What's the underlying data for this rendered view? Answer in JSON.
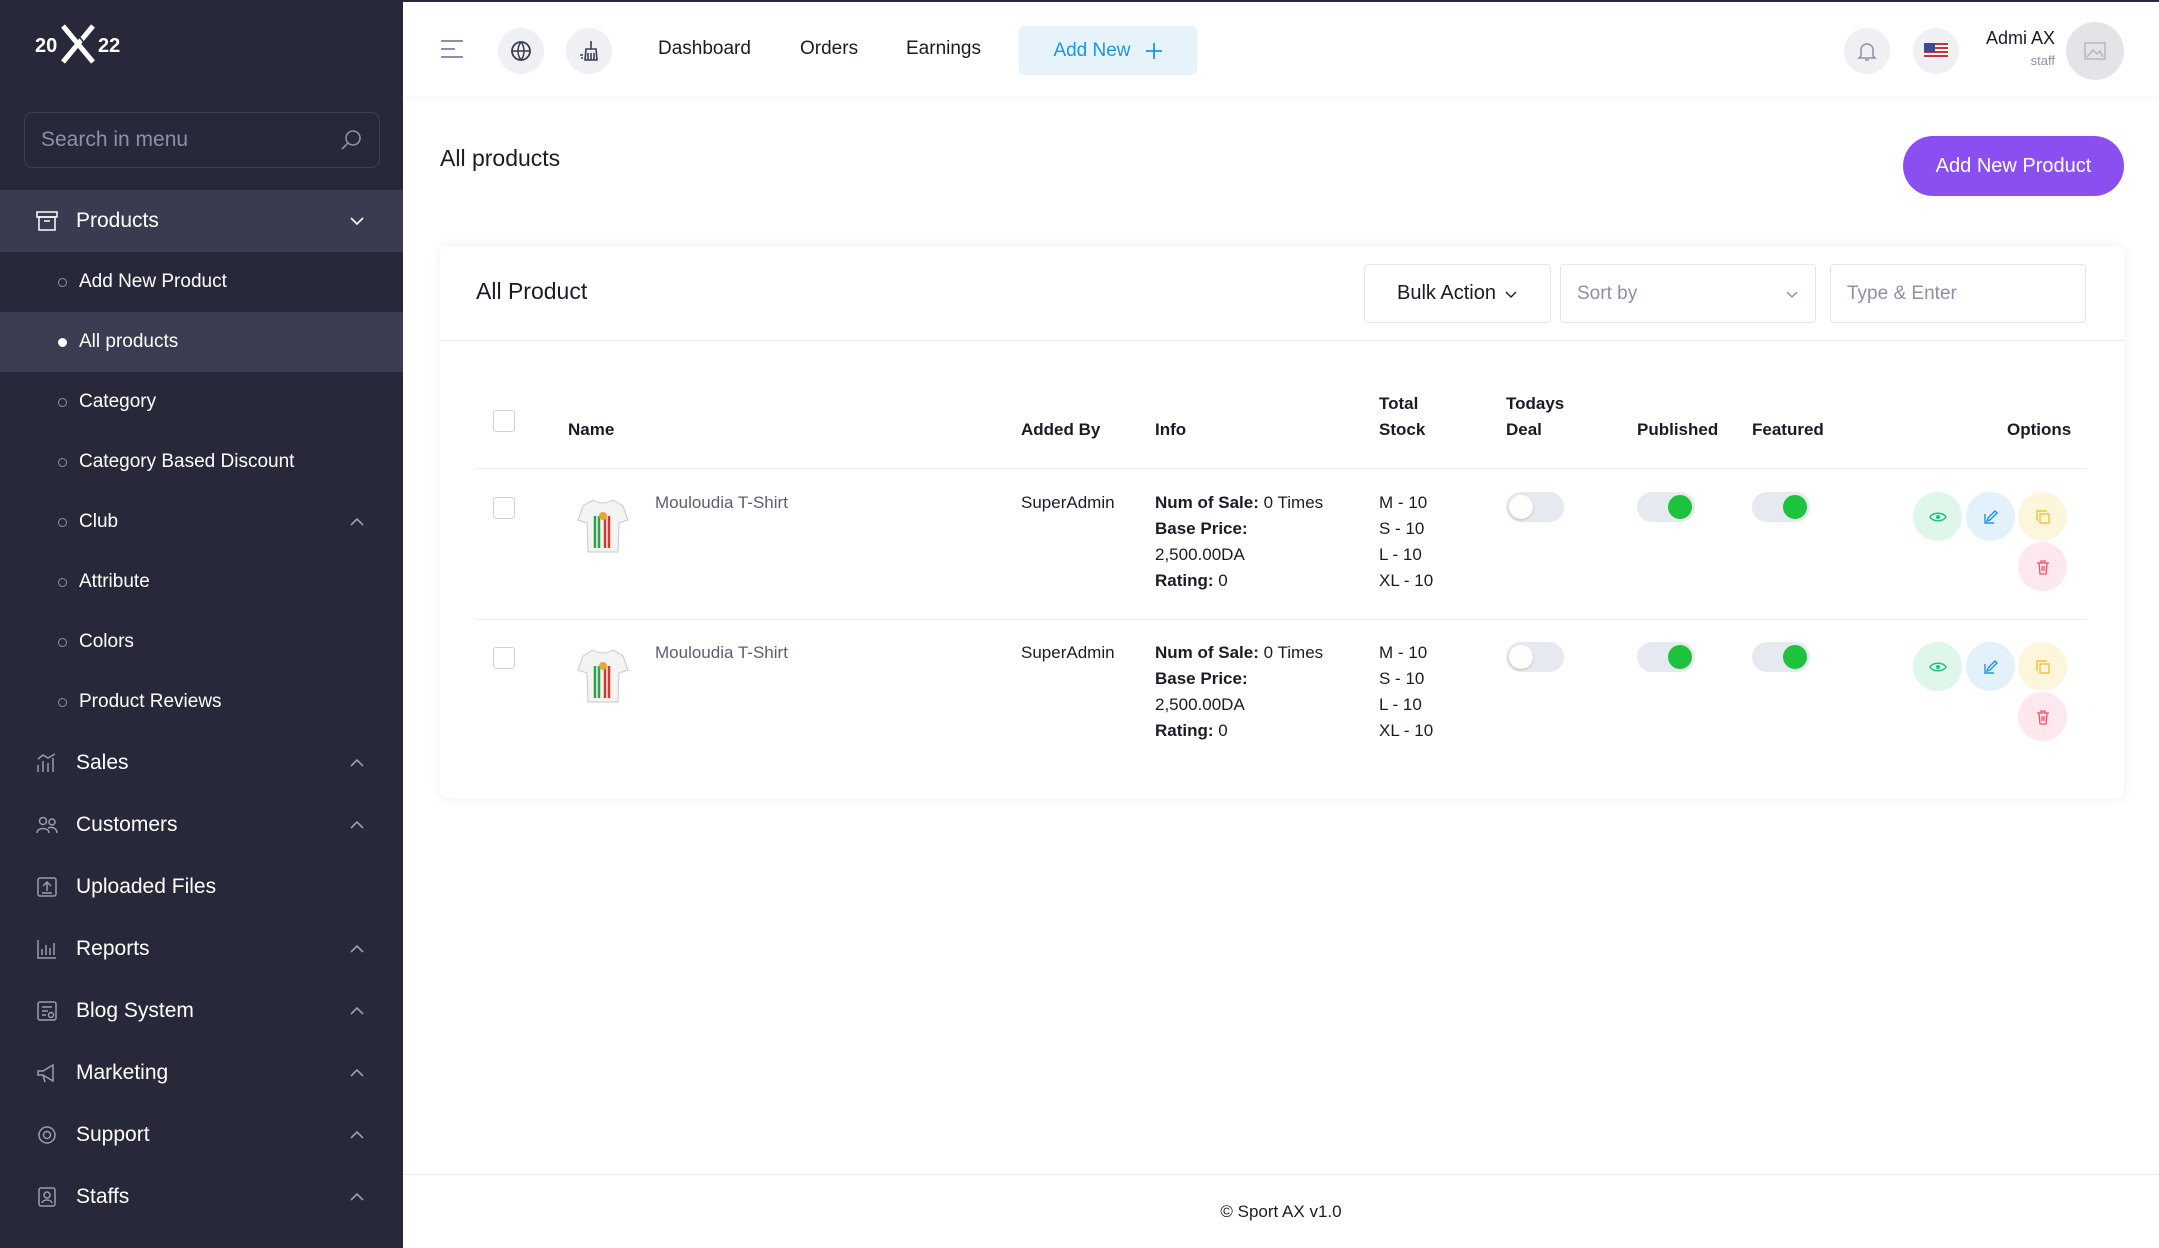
{
  "brand": {
    "logo_text": "20X22"
  },
  "sidebar": {
    "search_placeholder": "Search in menu",
    "products": {
      "label": "Products",
      "sub_items": [
        {
          "label": "Add New Product"
        },
        {
          "label": "All products"
        },
        {
          "label": "Category"
        },
        {
          "label": "Category Based Discount"
        },
        {
          "label": "Club"
        },
        {
          "label": "Attribute"
        },
        {
          "label": "Colors"
        },
        {
          "label": "Product Reviews"
        }
      ]
    },
    "items": [
      {
        "label": "Sales",
        "icon": "sales-icon"
      },
      {
        "label": "Customers",
        "icon": "customers-icon"
      },
      {
        "label": "Uploaded Files",
        "icon": "upload-icon"
      },
      {
        "label": "Reports",
        "icon": "reports-icon"
      },
      {
        "label": "Blog System",
        "icon": "blog-icon"
      },
      {
        "label": "Marketing",
        "icon": "megaphone-icon"
      },
      {
        "label": "Support",
        "icon": "support-icon"
      },
      {
        "label": "Staffs",
        "icon": "staff-icon"
      }
    ]
  },
  "topbar": {
    "links": [
      "Dashboard",
      "Orders",
      "Earnings"
    ],
    "add_new": "Add New",
    "user": {
      "name": "Admi AX",
      "role": "staff"
    }
  },
  "page": {
    "title": "All products",
    "add_button": "Add New Product"
  },
  "card": {
    "title": "All Product",
    "bulk_action": "Bulk Action",
    "sort_placeholder": "Sort by",
    "search_placeholder": "Type & Enter"
  },
  "table": {
    "headers": {
      "name": "Name",
      "added_by": "Added By",
      "info": "Info",
      "total_stock_1": "Total",
      "total_stock_2": "Stock",
      "todays_deal_1": "Todays",
      "todays_deal_2": "Deal",
      "published": "Published",
      "featured": "Featured",
      "options": "Options"
    },
    "rows": [
      {
        "name": "Mouloudia T-Shirt",
        "added_by": "SuperAdmin",
        "num_of_sale_label": "Num of Sale:",
        "num_of_sale_value": "0 Times",
        "base_price_label": "Base Price:",
        "base_price_value": "2,500.00DA",
        "rating_label": "Rating:",
        "rating_value": "0",
        "stock": [
          "M - 10",
          "S - 10",
          "L - 10",
          "XL - 10"
        ],
        "todays_deal": false,
        "published": true,
        "featured": true
      },
      {
        "name": "Mouloudia T-Shirt",
        "added_by": "SuperAdmin",
        "num_of_sale_label": "Num of Sale:",
        "num_of_sale_value": "0 Times",
        "base_price_label": "Base Price:",
        "base_price_value": "2,500.00DA",
        "rating_label": "Rating:",
        "rating_value": "0",
        "stock": [
          "M - 10",
          "S - 10",
          "L - 10",
          "XL - 10"
        ],
        "todays_deal": false,
        "published": true,
        "featured": true
      }
    ]
  },
  "footer": {
    "text": "© Sport AX v1.0"
  },
  "colors": {
    "sidebar_bg": "#27293a",
    "accent_purple": "#8b4ff1",
    "toggle_on": "#1ec33d",
    "link_blue": "#1f95df"
  }
}
